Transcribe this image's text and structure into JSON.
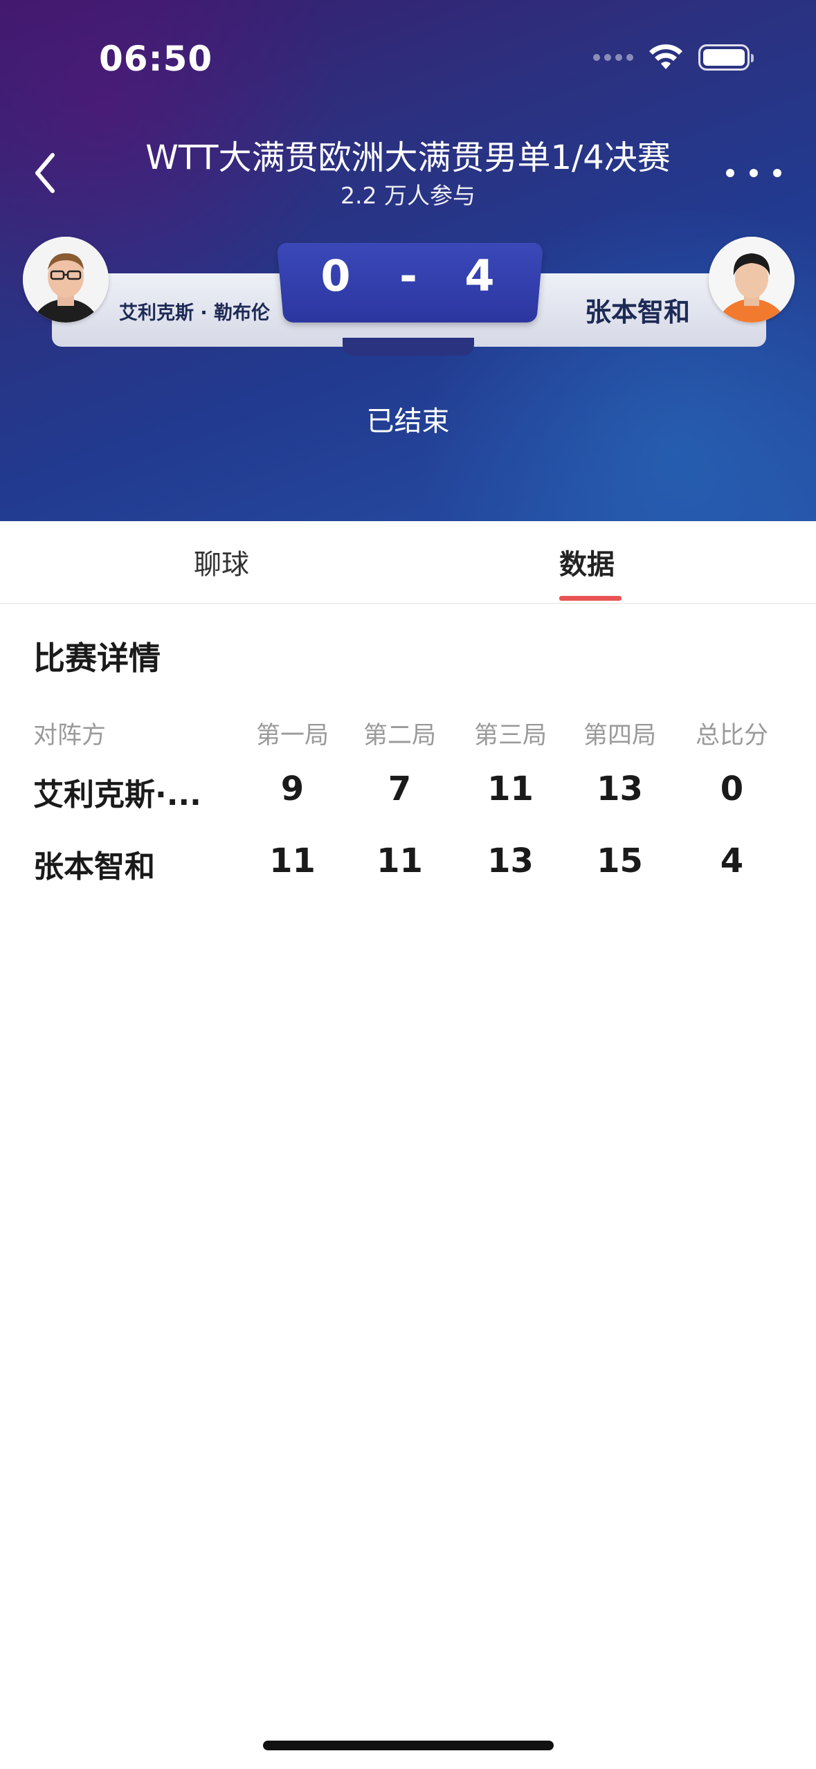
{
  "status_bar": {
    "time": "06:50"
  },
  "nav": {
    "title": "WTT大满贯欧洲大满贯男单1/4决赛",
    "participants": "2.2 万人参与"
  },
  "match": {
    "left_player": "艾利克斯 · 勒布伦",
    "right_player": "张本智和",
    "left_score": "0",
    "dash": "-",
    "right_score": "4",
    "status": "已结束"
  },
  "tabs": [
    {
      "label": "聊球",
      "active": false
    },
    {
      "label": "数据",
      "active": true
    }
  ],
  "details": {
    "title": "比赛详情",
    "columns": [
      "对阵方",
      "第一局",
      "第二局",
      "第三局",
      "第四局",
      "总比分"
    ],
    "rows": [
      {
        "name": "艾利克斯·...",
        "scores": [
          "9",
          "7",
          "11",
          "13"
        ],
        "total": "0"
      },
      {
        "name": "张本智和",
        "scores": [
          "11",
          "11",
          "13",
          "15"
        ],
        "total": "4"
      }
    ]
  },
  "colors": {
    "accent": "#e85454",
    "score_box": "#2b36a0"
  },
  "icons": [
    "back-icon",
    "more-icon",
    "wifi-icon",
    "battery-icon",
    "signal-icon"
  ]
}
